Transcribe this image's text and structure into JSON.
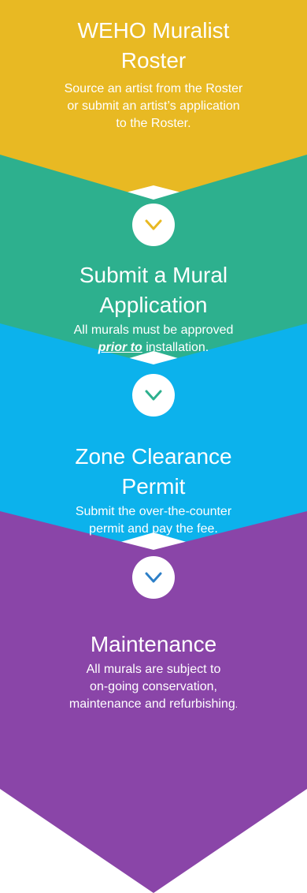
{
  "colors": {
    "step1": "#E8B923",
    "step2": "#2DB08E",
    "step3": "#0CB2EC",
    "step4": "#8A45A8",
    "chevron1": "#E8B923",
    "chevron2": "#2DB08E",
    "chevron3": "#2D7FC7"
  },
  "steps": [
    {
      "title_line1": "WEHO Muralist",
      "title_line2": "Roster",
      "desc_line1": "Source an artist from the Roster",
      "desc_line2": "or submit an artist’s application",
      "desc_line3": "to the Roster."
    },
    {
      "title_line1": "Submit a Mural",
      "title_line2": "Application",
      "desc_line1": "All murals must be approved",
      "desc_emph": "prior to",
      "desc_rest": " installation."
    },
    {
      "title_line1": "Zone Clearance",
      "title_line2": "Permit",
      "desc_line1": "Submit the over-the-counter",
      "desc_line2": "permit and pay the fee."
    },
    {
      "title_line1": "Maintenance",
      "desc_line1": "All murals are subject to",
      "desc_line2": "on-going conservation,",
      "desc_line3": "maintenance and refurbishing",
      "desc_trail": "."
    }
  ]
}
